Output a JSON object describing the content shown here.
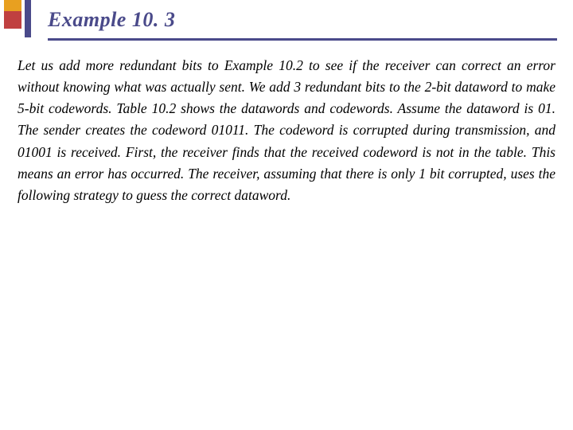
{
  "header": {
    "title": "Example 10. 3",
    "accent_colors": {
      "top": "#e8a020",
      "bottom": "#c04040",
      "bar": "#4a4a8a",
      "underline": "#4a4a8a"
    }
  },
  "content": {
    "body": "Let us add more redundant bits to Example 10.2 to see if the receiver can correct an error without knowing what was actually sent. We add 3 redundant bits to the 2-bit dataword to make 5-bit codewords. Table 10.2 shows the datawords and codewords. Assume the dataword is 01. The sender creates the codeword 01011. The codeword is corrupted during transmission, and 01001 is received. First, the receiver finds that the received codeword is not in the table. This means an error has occurred. The receiver, assuming that there is only 1 bit corrupted, uses the following strategy to guess the correct dataword."
  }
}
